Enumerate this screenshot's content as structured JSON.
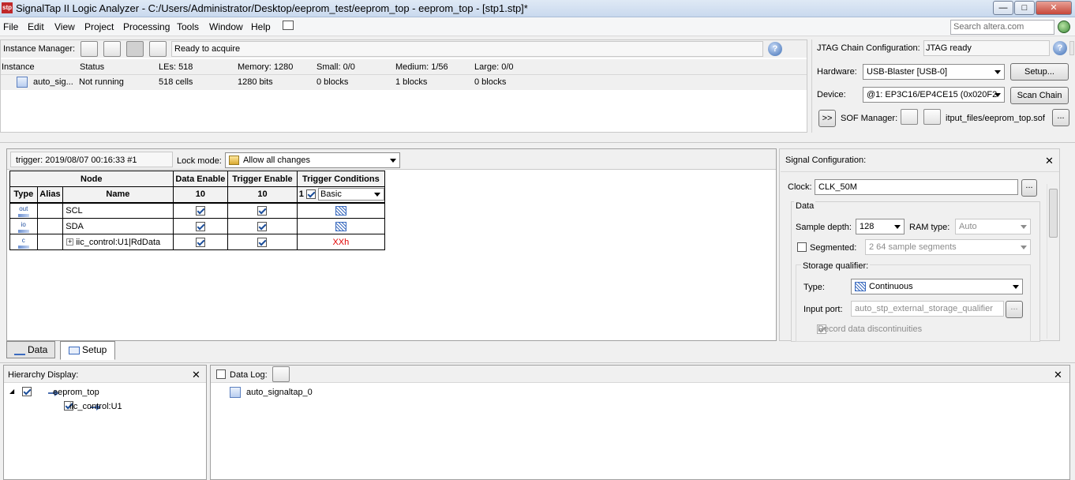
{
  "window": {
    "title": "SignalTap II Logic Analyzer - C:/Users/Administrator/Desktop/eeprom_test/eeprom_top - eeprom_top - [stp1.stp]*",
    "app_icon": "signaltap-logo-icon",
    "controls": {
      "minimize": "—",
      "maximize": "□",
      "close": "✕"
    }
  },
  "menubar": {
    "items": [
      {
        "label": "File",
        "key": "F"
      },
      {
        "label": "Edit",
        "key": "E"
      },
      {
        "label": "View",
        "key": "V"
      },
      {
        "label": "Project",
        "key": "P"
      },
      {
        "label": "Processing",
        "key": "r"
      },
      {
        "label": "Tools",
        "key": "T"
      },
      {
        "label": "Window",
        "key": "W"
      },
      {
        "label": "Help",
        "key": "H"
      }
    ],
    "search_placeholder": "Search altera.com"
  },
  "instance_manager": {
    "label": "Instance Manager:",
    "status": "Ready to acquire",
    "help": "?",
    "columns": [
      "Instance",
      "Status",
      "LEs: 518",
      "Memory: 1280",
      "Small: 0/0",
      "Medium: 1/56",
      "Large: 0/0"
    ],
    "rows": [
      {
        "instance": "auto_sig...",
        "status": "Not running",
        "les": "518 cells",
        "memory": "1280 bits",
        "small": "0 blocks",
        "medium": "1 blocks",
        "large": "0 blocks"
      }
    ]
  },
  "jtag": {
    "label": "JTAG Chain Configuration:",
    "status": "JTAG ready",
    "hardware_label": "Hardware:",
    "hardware_value": "USB-Blaster [USB-0]",
    "setup_button": "Setup...",
    "device_label": "Device:",
    "device_value": "@1: EP3C16/EP4CE15 (0x020F2",
    "scan_button": "Scan Chain",
    "expand_button": ">>",
    "sof_label": "SOF Manager:",
    "sof_file": "itput_files/eeprom_top.sof",
    "browse_button": "..."
  },
  "setup": {
    "trigger_info": "trigger: 2019/08/07 00:16:33  #1",
    "lock_label": "Lock mode:",
    "lock_value": "Allow all changes",
    "table": {
      "h_node": "Node",
      "h_data_enable": "Data Enable",
      "h_trigger_enable": "Trigger Enable",
      "h_trigger_conditions": "Trigger Conditions",
      "h_type": "Type",
      "h_alias": "Alias",
      "h_name": "Name",
      "data_enable_count": "10",
      "trigger_enable_count": "10",
      "cond_index": "1",
      "cond_mode": "Basic",
      "rows": [
        {
          "type": "out",
          "name": "SCL",
          "expand": "",
          "cond": "pattern"
        },
        {
          "type": "io",
          "name": "SDA",
          "expand": "",
          "cond": "pattern"
        },
        {
          "type": "c",
          "name": "iic_control:U1|RdData",
          "expand": "+",
          "cond": "XXh"
        }
      ]
    },
    "tabs": [
      "Data",
      "Setup"
    ]
  },
  "signal_config": {
    "title": "Signal Configuration:",
    "clock_label": "Clock:",
    "clock_value": "CLK_50M",
    "data_group": "Data",
    "sample_depth_label": "Sample depth:",
    "sample_depth_value": "128",
    "ram_type_label": "RAM type:",
    "ram_type_value": "Auto",
    "segmented_label": "Segmented:",
    "segmented_value": "2  64 sample segments",
    "storage_group": "Storage qualifier:",
    "type_label": "Type:",
    "type_value": "Continuous",
    "input_port_label": "Input port:",
    "input_port_value": "auto_stp_external_storage_qualifier",
    "record_label": "Record data discontinuities"
  },
  "hierarchy": {
    "title": "Hierarchy Display:",
    "items": [
      {
        "label": "eeprom_top",
        "expand": "◢"
      },
      {
        "label": "iic_control:U1",
        "expand": ""
      }
    ]
  },
  "datalog": {
    "title": "Data Log:",
    "items": [
      "auto_signaltap_0"
    ]
  },
  "colors": {
    "accent": "#3b6bbf",
    "xx_red": "#e00000"
  }
}
